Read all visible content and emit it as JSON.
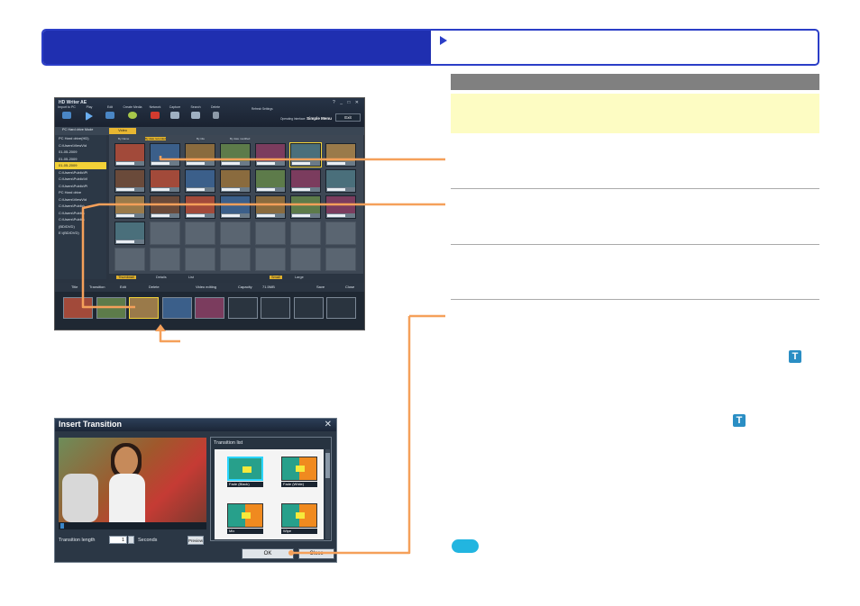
{
  "app": {
    "title": "HD Writer AE",
    "toolbar": [
      {
        "label": "Import to PC",
        "icon": "import-icon"
      },
      {
        "label": "Play",
        "icon": "play-icon"
      },
      {
        "label": "Edit",
        "icon": "edit-icon"
      },
      {
        "label": "Create Media",
        "icon": "disc-icon"
      },
      {
        "label": "Network",
        "icon": "youtube-icon"
      },
      {
        "label": "Capture",
        "icon": "camera-icon"
      },
      {
        "label": "Search",
        "icon": "search-icon"
      },
      {
        "label": "Delete",
        "icon": "trash-icon"
      }
    ],
    "refresh_label": "Refresh  Settings",
    "operating_interface_label": "Operating Interface:",
    "simple_menu_label": "Simple Menu",
    "exit_label": "Exit",
    "mode_label": "PC Hard drive Mode",
    "video_tab": "Video",
    "columns": [
      "By Name",
      "By date recorded",
      "By title",
      "By date modified"
    ],
    "tree": [
      "PC Hard drive(HD)",
      "C:\\Users\\ViewVid",
      "01-05-2009",
      "01-05-2009",
      "01-05-2009",
      "C:\\Users\\Public\\Pi",
      "C:\\Users\\Public\\Vi",
      "C:\\Users\\Public\\Pi",
      "PC Hard drive",
      "C:\\Users\\ViewVid",
      "C:\\Users\\Public\\",
      "C:\\Users\\Public\\",
      "C:\\Users\\Public\\",
      "(BD/DVD)",
      "E:\\(BD/DVD)"
    ],
    "view_bar": [
      "Thumbnail",
      "Details",
      "List",
      "Small",
      "Large"
    ],
    "strip_bar": [
      "Title",
      "Transition",
      "Edit",
      "Delete",
      "Video editing",
      "Capacity",
      "Save",
      "Close"
    ],
    "capacity_value": "71.5MB"
  },
  "dialog": {
    "title": "Insert Transition",
    "transition_list_label": "Transition list",
    "transitions": [
      "Fade (Black)",
      "Fade (White)",
      "Mix",
      "Wipe"
    ],
    "length_label": "Transition length",
    "length_value": "1",
    "seconds_label": "Seconds",
    "preview_label": "Preview",
    "ok_label": "OK",
    "close_label": "Close"
  },
  "colors": {
    "header_blue": "#1f2fb0",
    "callout_orange": "#f5a05a",
    "info_yellow": "#fdfcc3",
    "accent_cyan": "#22b5e0"
  }
}
